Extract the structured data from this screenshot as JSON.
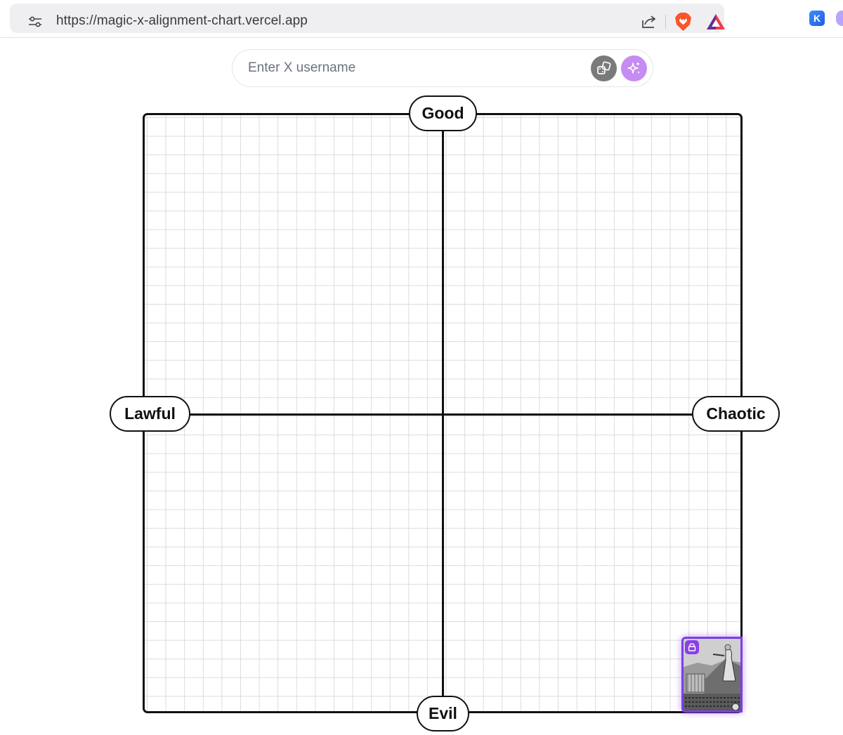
{
  "browser": {
    "url": "https://magic-x-alignment-chart.vercel.app",
    "icons": [
      "site-settings-icon",
      "share-icon",
      "brave-shield-icon",
      "brave-rewards-icon",
      "extension-k-icon",
      "extension-icon"
    ]
  },
  "search": {
    "placeholder": "Enter X username",
    "value": "",
    "random_button_icon": "dice-icon",
    "magic_button_icon": "sparkles-icon"
  },
  "chart": {
    "axis_labels": {
      "top": "Good",
      "bottom": "Evil",
      "left": "Lawful",
      "right": "Chaotic"
    },
    "grid": true
  },
  "placed_avatars": [
    {
      "locked": true,
      "icon": "lock-icon",
      "position": "bottom-right corner (max Chaotic, max Evil)"
    }
  ],
  "colors": {
    "accent_purple": "#8b3fe8",
    "magic_button": "#c58cf2",
    "random_button": "#7a7a7a",
    "axis": "#111111",
    "grid": "#dcdcdc"
  }
}
